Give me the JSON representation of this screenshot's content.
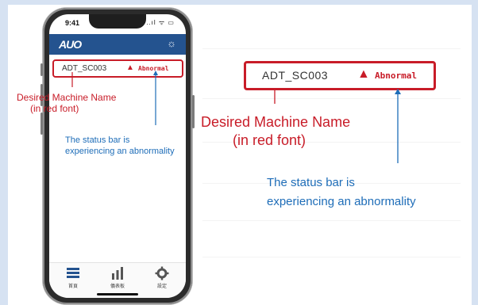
{
  "phone": {
    "time": "9:41",
    "signal": "..ıl ᯤ ▭",
    "logo": "AUO",
    "machine_name": "ADT_SC003",
    "status": "Abnormal",
    "tabs": [
      {
        "label": "首頁"
      },
      {
        "label": "儀表板"
      },
      {
        "label": "設定"
      }
    ]
  },
  "zoom": {
    "machine_name": "ADT_SC003",
    "status": "Abnormal"
  },
  "annotations": {
    "name_line1": "Desired Machine Name",
    "name_line2": "(in red font)",
    "status_line1": "The status bar is",
    "status_line2": "experiencing an abnormality"
  },
  "colors": {
    "accent_red": "#c81c28",
    "annotation_blue": "#1e6db8",
    "header_blue": "#24538f"
  }
}
